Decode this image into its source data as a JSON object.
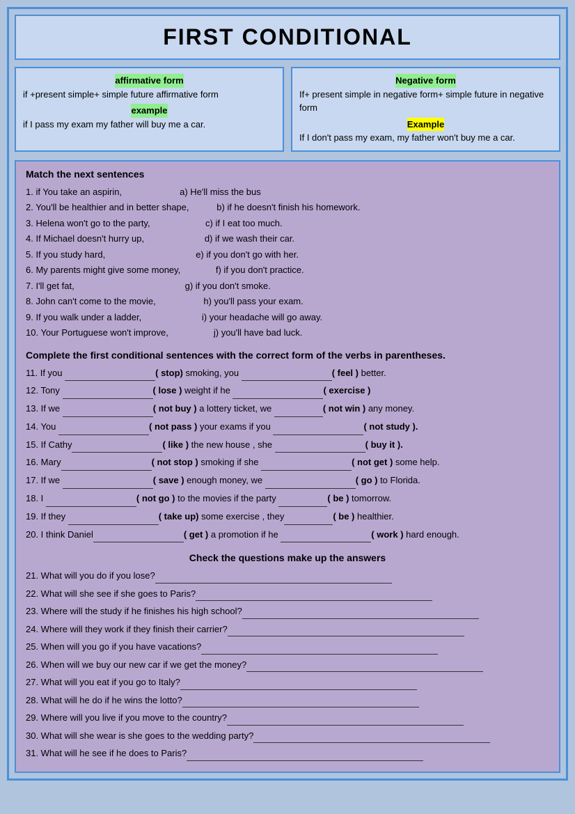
{
  "title": "FIRST CONDITIONAL",
  "affirmative": {
    "label": "affirmative form",
    "rule": "if +present simple+ simple future affirmative form",
    "example_label": "example",
    "example": "if I pass my exam my father will buy me a car."
  },
  "negative": {
    "label": "Negative form",
    "rule": "If+ present simple in negative form+ simple future in negative form",
    "example_label": "Example",
    "example": "If I don't pass my exam, my father won't buy me a car."
  },
  "section1_title": "Match the next sentences",
  "sentences": [
    {
      "num": "1.",
      "left": "if You take an aspirin,",
      "right": "a) He'll miss the bus"
    },
    {
      "num": "2.",
      "left": "You'll be healthier and in better shape,",
      "right": "b) if he doesn't  finish his homework."
    },
    {
      "num": "3.",
      "left": "Helena won't go to the party,",
      "right": "c) if I eat too much."
    },
    {
      "num": "4.",
      "left": "If Michael doesn't hurry up,",
      "right": "d) if we wash their car."
    },
    {
      "num": "5.",
      "left": "If you study hard,",
      "right": "e) if you don't go with her."
    },
    {
      "num": "6.",
      "left": "My parents might give some money,",
      "right": "f) if you don't practice."
    },
    {
      "num": "7.",
      "left": "I'll get fat,",
      "right": "g) if you don't smoke."
    },
    {
      "num": "8.",
      "left": "John can't come to the movie,",
      "right": "h) you'll pass your exam."
    },
    {
      "num": "9.",
      "left": "If you walk under a ladder,",
      "right": "i) your headache will go away."
    },
    {
      "num": "10.",
      "left": "Your Portuguese won't improve,",
      "right": "j) you'll have bad luck."
    }
  ],
  "section2_title": "Complete the first conditional sentences with the correct form of the verbs in parentheses.",
  "exercises": [
    {
      "num": "11.",
      "text": "If you",
      "blank1": "",
      "verb1": "( stop)",
      "mid": "smoking, you",
      "blank2": "",
      "verb2": "( feel )",
      "end": "better."
    },
    {
      "num": "12.",
      "text": "Tony",
      "blank1": "",
      "verb1": "( lose )",
      "mid": "weight if he",
      "blank2": "",
      "verb2": "( exercise )",
      "end": ""
    },
    {
      "num": "13.",
      "text": "If we",
      "blank1": "",
      "verb1": "( not buy )",
      "mid": "a lottery ticket, we",
      "blank2": "",
      "verb2": "( not win )",
      "end": "any money."
    },
    {
      "num": "14.",
      "text": "You",
      "blank1": "",
      "verb1": "( not pass )",
      "mid": "your exams if you",
      "blank2": "",
      "verb2": "( not study ).",
      "end": ""
    },
    {
      "num": "15.",
      "text": "If Cathy",
      "blank1": "",
      "verb1": "( like )",
      "mid": "the new house , she",
      "blank2": "",
      "verb2": "( buy it ).",
      "end": ""
    },
    {
      "num": "16.",
      "text": "Mary",
      "blank1": "",
      "verb1": "( not stop )",
      "mid": "smoking if she",
      "blank2": "",
      "verb2": "( not get )",
      "end": "some help."
    },
    {
      "num": "17.",
      "text": "If we",
      "blank1": "",
      "verb1": "( save )",
      "mid": "enough money, we",
      "blank2": "",
      "verb2": "( go )",
      "end": "to Florida."
    },
    {
      "num": "18.",
      "text": "I",
      "blank1": "",
      "verb1": "( not go )",
      "mid": "to the movies if the party",
      "blank2": "",
      "verb2": "( be )",
      "end": "tomorrow."
    },
    {
      "num": "19.",
      "text": "If they",
      "blank1": "",
      "verb1": "( take up)",
      "mid": "some exercise , they",
      "blank2": "",
      "verb2": "( be )",
      "end": "healthier."
    },
    {
      "num": "20.",
      "text": "I think Daniel",
      "blank1": "",
      "verb1": "( get )",
      "mid": "a promotion if he",
      "blank2": "",
      "verb2": "( work )",
      "end": "hard enough."
    }
  ],
  "section3_title": "Check  the questions make up the answers",
  "questions": [
    {
      "num": "21.",
      "text": "What will you do if you lose?"
    },
    {
      "num": "22.",
      "text": "What will she see if she goes to Paris?"
    },
    {
      "num": "23.",
      "text": "Where will the study if he finishes his high school?"
    },
    {
      "num": "24.",
      "text": "Where will they work if they finish their carrier?"
    },
    {
      "num": "25.",
      "text": "When will you go if you have  vacations?"
    },
    {
      "num": "26.",
      "text": "When will we buy our new car if we get the money?"
    },
    {
      "num": "27.",
      "text": "What will you eat if you go to Italy?"
    },
    {
      "num": "28.",
      "text": "What will he do if he wins the lotto?"
    },
    {
      "num": "29.",
      "text": "Where will you live if you move to the country?"
    },
    {
      "num": "30.",
      "text": "What will she wear is she goes to the wedding party?"
    },
    {
      "num": "31.",
      "text": "What will he see if he does to Paris?"
    }
  ]
}
